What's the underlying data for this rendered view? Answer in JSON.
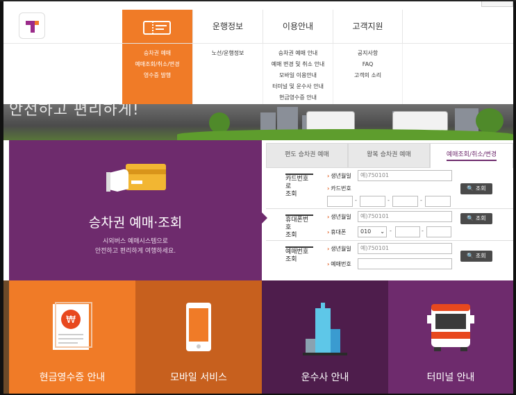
{
  "nav": {
    "items": [
      {
        "label": ""
      },
      {
        "label": "운행정보"
      },
      {
        "label": "이용안내"
      },
      {
        "label": "고객지원"
      }
    ],
    "dropdown": {
      "col1": [
        "승차권 예매",
        "예매조회/취소/변경",
        "영수증 발행"
      ],
      "col2": [
        "노선/운행정보"
      ],
      "col3": [
        "승차권 예매 안내",
        "예매 변경 및 취소 안내",
        "모바일 이용안내",
        "터미널 및 운수사 안내",
        "현금영수증 안내"
      ],
      "col4": [
        "공지사항",
        "FAQ",
        "고객의 소리"
      ]
    }
  },
  "hero": {
    "text": "안전하고 편리하게!"
  },
  "booking": {
    "title": "승차권 예매·조회",
    "desc1": "시외버스 예매시스템으로",
    "desc2": "안전하고 편리하게 여행하세요.",
    "tabs": [
      "편도 승차권 예매",
      "왕복 승차권 예매",
      "예매조회/취소/변경"
    ],
    "card": {
      "label1": "카드번호로",
      "label2": "조회",
      "birth_label": "생년월일",
      "birth_placeholder": "예)750101",
      "card_label": "카드번호"
    },
    "phone": {
      "label1": "휴대폰번호",
      "label2": "조회",
      "birth_label": "생년월일",
      "birth_placeholder": "예)750101",
      "phone_label": "휴대폰",
      "prefix": "010"
    },
    "reservation": {
      "label1": "예매번호",
      "label2": "조회",
      "birth_label": "생년월일",
      "birth_placeholder": "예)750101",
      "number_label": "예매번호"
    },
    "search_label": "조회"
  },
  "tiles": [
    {
      "label": "현금영수증 안내"
    },
    {
      "label": "모바일 서비스"
    },
    {
      "label": "운수사 안내"
    },
    {
      "label": "터미널 안내"
    }
  ],
  "colors": {
    "orange": "#f07b27",
    "purple": "#6e2b6d"
  }
}
